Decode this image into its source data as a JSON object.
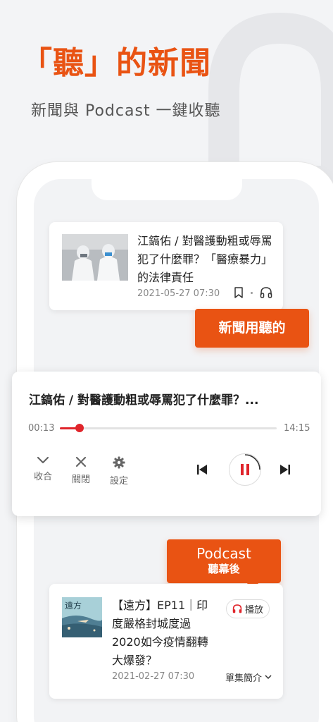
{
  "hero": {
    "title": "「聽」的新聞",
    "subtitle": "新聞與 Podcast 一鍵收聽"
  },
  "article_card": {
    "title": "江鎬佑 / 對醫護動粗或辱罵犯了什麼罪？「醫療暴力」的法律責任",
    "date": "2021-05-27 07:30",
    "icons": [
      "bookmark-icon",
      "headphones-icon"
    ]
  },
  "callout_listen": {
    "label": "新聞用聽的"
  },
  "player": {
    "title": "江鎬佑 / 對醫護動粗或辱罵犯了什麼罪？...",
    "elapsed": "00:13",
    "duration": "14:15",
    "progress_fraction": 0.092,
    "controls": {
      "collapse_label": "收合",
      "close_label": "關閉",
      "settings_label": "設定"
    }
  },
  "callout_podcast": {
    "line1": "Podcast",
    "line2": "聽幕後"
  },
  "podcast_card": {
    "title": "【遠方】EP11｜印度嚴格封城度過2020如今疫情翻轉大爆發？",
    "play_label": "播放",
    "date": "2021-02-27 07:30",
    "more_label": "單集簡介",
    "thumbnail_text": "遠方"
  },
  "colors": {
    "accent": "#e95313",
    "progress": "#e0252b",
    "background": "#f3f4f6"
  }
}
